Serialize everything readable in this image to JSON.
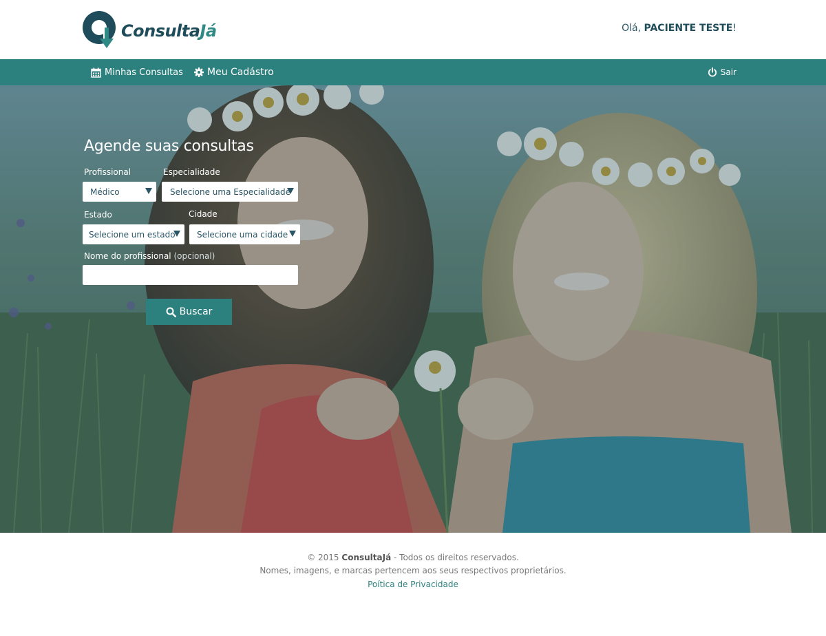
{
  "header": {
    "logo_text_part1": "Consulta",
    "logo_text_part2": "Já",
    "greeting_prefix": "Olá,",
    "user_name": "PACIENTE TESTE",
    "greeting_suffix": "!"
  },
  "nav": {
    "minhas_consultas": "Minhas Consultas",
    "meu_cadastro": "Meu Cadástro",
    "sair": "Sair"
  },
  "form": {
    "title": "Agende suas consultas",
    "profissional_label": "Profissional",
    "profissional_value": "Médico",
    "especialidade_label": "Especialidade",
    "especialidade_value": "Selecione uma Especialidade",
    "estado_label": "Estado",
    "estado_value": "Selecione um estado",
    "cidade_label": "Cidade",
    "cidade_value": "Selecione uma cidade",
    "nome_label": "Nome do profissional",
    "nome_optional": "(opcional)",
    "nome_value": "",
    "button_label": "Buscar"
  },
  "footer": {
    "copyright_prefix": "© 2015",
    "brand": "ConsultaJá",
    "copyright_suffix": "- Todos os direitos reservados.",
    "disclaimer": "Nomes, imagens, e marcas pertencem aos seus respectivos proprietários.",
    "privacy_link": "Poítica de Privacidade"
  },
  "colors": {
    "brand_dark": "#1f4c5a",
    "brand_teal": "#2c807e",
    "text_dark": "#2a5666"
  }
}
